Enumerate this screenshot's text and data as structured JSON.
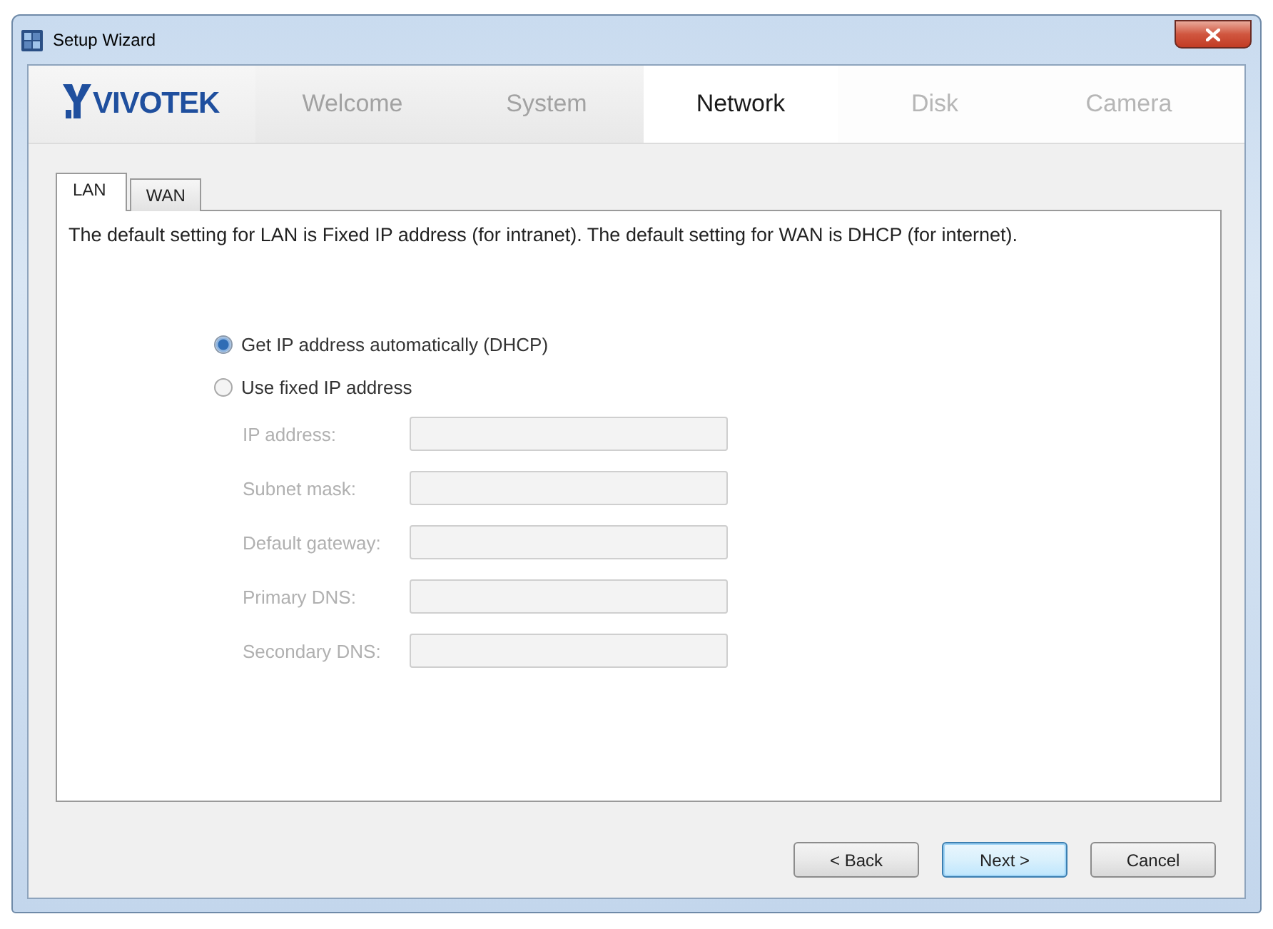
{
  "window": {
    "title": "Setup Wizard"
  },
  "header": {
    "logo": "VIVOTEK",
    "steps": [
      {
        "label": "Welcome",
        "completed": true,
        "selected": false
      },
      {
        "label": "System",
        "completed": true,
        "selected": false
      },
      {
        "label": "Network",
        "completed": false,
        "selected": true
      },
      {
        "label": "Disk",
        "completed": false,
        "selected": false
      },
      {
        "label": "Camera",
        "completed": false,
        "selected": false
      }
    ]
  },
  "tabs": [
    {
      "label": "LAN",
      "selected": true
    },
    {
      "label": "WAN",
      "selected": false
    }
  ],
  "description": "The default setting for LAN is Fixed IP address (for intranet). The default setting for WAN is DHCP (for internet).",
  "ip_mode": [
    {
      "label": "Get IP address automatically (DHCP)",
      "selected": true
    },
    {
      "label": "Use fixed IP address",
      "selected": false
    }
  ],
  "fields": [
    {
      "label": "IP address:",
      "disabled": true
    },
    {
      "label": "Subnet mask:",
      "disabled": true
    },
    {
      "label": "Default gateway:",
      "disabled": true
    },
    {
      "label": "Primary DNS:",
      "disabled": true
    },
    {
      "label": "Secondary DNS:",
      "disabled": true
    }
  ],
  "buttons": [
    {
      "label": "< Back",
      "focused": false
    },
    {
      "label": "Next >",
      "focused": true
    },
    {
      "label": "Cancel",
      "focused": false
    }
  ]
}
